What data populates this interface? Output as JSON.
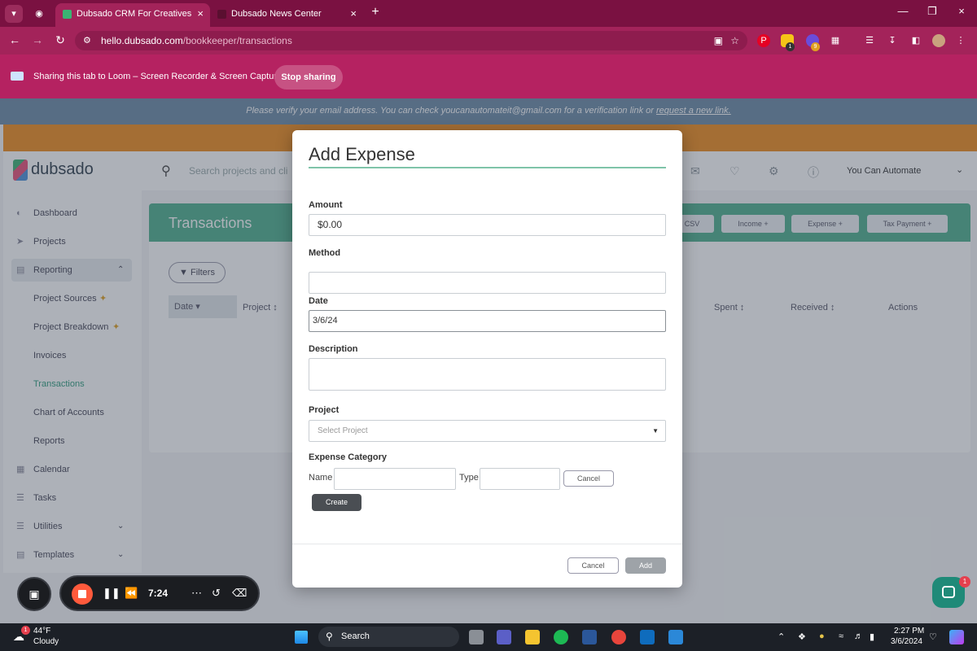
{
  "browser": {
    "tabs": [
      {
        "title": "Dubsado CRM For Creatives",
        "active": true
      },
      {
        "title": "Dubsado News Center",
        "active": false
      }
    ],
    "url_host": "hello.dubsado.com",
    "url_path": "/bookkeeper/transactions",
    "extension_badges": [
      "1",
      "9"
    ]
  },
  "loom": {
    "sharing_text": "Sharing this tab to Loom – Screen Recorder & Screen Capture",
    "stop_label": "Stop sharing"
  },
  "verify_banner": {
    "text": "Please verify your email address. You can check youcanautomateit@gmail.com for a verification link or ",
    "link": "request a new link."
  },
  "header": {
    "logo": "dubsado",
    "search_placeholder": "Search projects and cli",
    "user_name": "You Can Automate"
  },
  "sidebar": {
    "items": [
      {
        "label": "Dashboard",
        "icon": "dashboard-icon"
      },
      {
        "label": "Projects",
        "icon": "projects-icon"
      },
      {
        "label": "Reporting",
        "icon": "reporting-icon"
      },
      {
        "label": "Project Sources"
      },
      {
        "label": "Project Breakdown"
      },
      {
        "label": "Invoices"
      },
      {
        "label": "Transactions"
      },
      {
        "label": "Chart of Accounts"
      },
      {
        "label": "Reports"
      },
      {
        "label": "Calendar",
        "icon": "calendar-icon"
      },
      {
        "label": "Tasks",
        "icon": "tasks-icon"
      },
      {
        "label": "Utilities",
        "icon": "utilities-icon"
      },
      {
        "label": "Templates",
        "icon": "templates-icon"
      }
    ]
  },
  "transactions": {
    "title": "Transactions",
    "buttons": {
      "csv": "CSV",
      "income": "Income",
      "expense": "Expense",
      "tax_payment": "Tax Payment"
    },
    "filters_label": "Filters",
    "columns": {
      "date": "Date",
      "project": "Project",
      "spent": "Spent",
      "received": "Received",
      "actions": "Actions"
    }
  },
  "modal": {
    "title": "Add Expense",
    "amount_label": "Amount",
    "amount_value": "$0.00",
    "method_label": "Method",
    "method_value": "",
    "date_label": "Date",
    "date_value": "3/6/24",
    "description_label": "Description",
    "description_value": "",
    "project_label": "Project",
    "project_placeholder": "Select Project",
    "expense_category_label": "Expense Category",
    "name_label": "Name",
    "type_label": "Type",
    "inline_cancel_label": "Cancel",
    "create_label": "Create",
    "cancel_label": "Cancel",
    "add_label": "Add"
  },
  "recorder": {
    "time": "7:24"
  },
  "chat": {
    "badge": "1"
  },
  "taskbar": {
    "weather_temp": "44°F",
    "weather_cond": "Cloudy",
    "weather_badge": "1",
    "search_label": "Search",
    "time": "2:27 PM",
    "date": "3/6/2024"
  },
  "colors": {
    "brand_green": "#4fb08d",
    "browser_bar": "#a3235a",
    "orange_band": "#f08c1c"
  }
}
